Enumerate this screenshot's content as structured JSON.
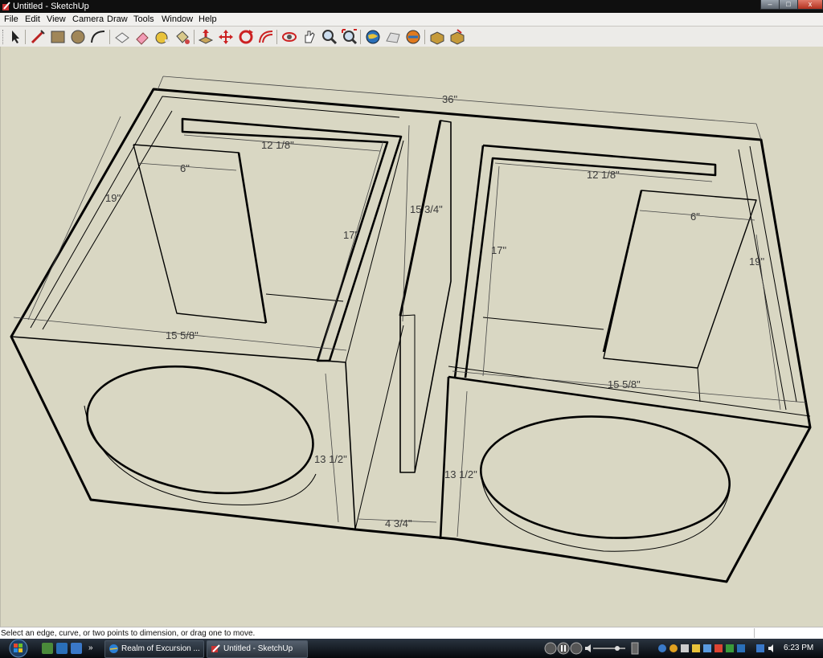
{
  "window": {
    "title": "Untitled - SketchUp",
    "minimize_label": "–",
    "maximize_label": "□",
    "close_label": "x"
  },
  "menu": [
    "File",
    "Edit",
    "View",
    "Camera",
    "Draw",
    "Tools",
    "Window",
    "Help"
  ],
  "toolbar": {
    "tools": [
      "select-tool",
      "line-tool",
      "rectangle-tool",
      "circle-tool",
      "arc-tool",
      "make-component-tool",
      "eraser-tool",
      "tape-measure-tool",
      "paint-bucket-tool",
      "push-pull-tool",
      "move-tool",
      "rotate-tool",
      "offset-tool",
      "orbit-tool",
      "pan-tool",
      "zoom-tool",
      "zoom-extents-tool",
      "get-models-tool",
      "share-model-tool",
      "google-earth-tool",
      "components-tool",
      "materials-tool"
    ]
  },
  "model": {
    "dimensions": {
      "overall_width": "36\"",
      "left_top_chamber": "12 1/8\"",
      "left_port": "6\"",
      "left_depth": "19\"",
      "left_height": "17\"",
      "center_divider": "15 3/4\"",
      "left_bottom": "15 5/8\"",
      "left_front_height": "13 1/2\"",
      "center_gap": "4 3/4\"",
      "right_top_chamber": "12 1/8\"",
      "right_port": "6\"",
      "right_height": "17\"",
      "right_depth": "19\"",
      "right_bottom": "15 5/8\"",
      "right_front_height": "13 1/2\""
    }
  },
  "status": {
    "message": "Select an edge, curve, or two points to dimension, or drag one to move."
  },
  "taskbar": {
    "tasks": [
      {
        "label": "Realm of Excursion ..."
      },
      {
        "label": "Untitled - SketchUp"
      }
    ],
    "clock": "6:23 PM"
  },
  "colors": {
    "viewport_bg": "#d9d7c3",
    "edge": "#000000",
    "dimension": "#3a3a3a"
  }
}
